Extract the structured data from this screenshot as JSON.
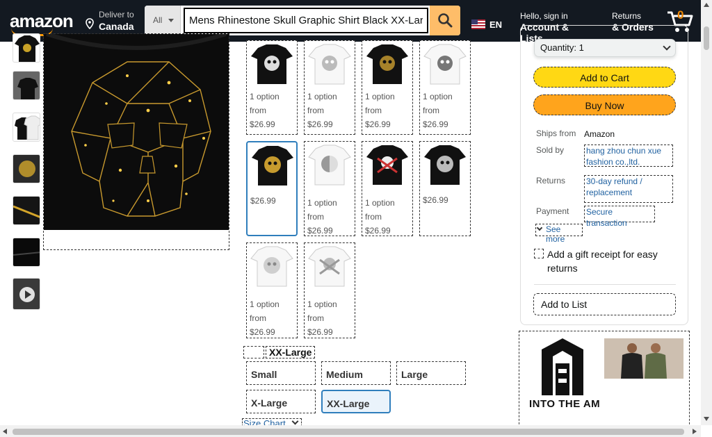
{
  "header": {
    "logo_text": "amazon",
    "deliver_label": "Deliver to",
    "deliver_location": "Canada",
    "search_category": "All",
    "search_value": "Mens Rhinestone Skull Graphic Shirt Black XX-Large",
    "language": "EN",
    "account_top": "Hello, sign in",
    "account_bottom": "Account & Lists",
    "returns_top": "Returns",
    "returns_bottom": "& Orders",
    "cart_count": "0"
  },
  "variations": [
    {
      "line1": "1 option",
      "line2": "from",
      "price": "$26.99",
      "style": "black-white-skull"
    },
    {
      "line1": "1 option",
      "line2": "from",
      "price": "$26.99",
      "style": "white-skull"
    },
    {
      "line1": "1 option",
      "line2": "from",
      "price": "$26.99",
      "style": "black-gold-skull"
    },
    {
      "line1": "1 option",
      "line2": "from",
      "price": "$26.99",
      "style": "white-gray-skull"
    },
    {
      "price": "$26.99",
      "style": "black-gold-selected"
    },
    {
      "line1": "1 option",
      "line2": "from",
      "price": "$26.99",
      "style": "white-half-skull"
    },
    {
      "line1": "1 option",
      "line2": "from",
      "price": "$26.99",
      "style": "black-pirate-skull"
    },
    {
      "price": "$26.99",
      "style": "black-silver-skull"
    },
    {
      "line1": "1 option",
      "line2": "from",
      "price": "$26.99",
      "style": "white-silver-skull"
    },
    {
      "line1": "1 option",
      "line2": "from",
      "price": "$26.99",
      "style": "white-pirate-skull"
    }
  ],
  "size": {
    "selected_label": "XX-Large",
    "options": [
      "Small",
      "Medium",
      "Large",
      "X-Large",
      "XX-Large"
    ],
    "chart_link": "Size Chart"
  },
  "buybox": {
    "quantity": "Quantity: 1",
    "add_to_cart": "Add to Cart",
    "buy_now": "Buy Now",
    "ships_from_label": "Ships from",
    "ships_from_value": "Amazon",
    "sold_by_label": "Sold by",
    "sold_by_value": "hang zhou chun xue fashion co.,ltd.",
    "returns_label": "Returns",
    "returns_value": "30-day refund / replacement",
    "payment_label": "Payment",
    "payment_value": "Secure transaction",
    "see_more": "See more",
    "gift_receipt": "Add a gift receipt for easy returns",
    "add_to_list": "Add to List"
  },
  "ad": {
    "brand": "INTO THE AM"
  },
  "colors": {
    "nav_bg": "#131921",
    "accent": "#ff9900",
    "cart_button": "#ffd814",
    "buy_button": "#ffa41c",
    "link": "#2162a1",
    "selected_border": "#2f7ebc"
  }
}
